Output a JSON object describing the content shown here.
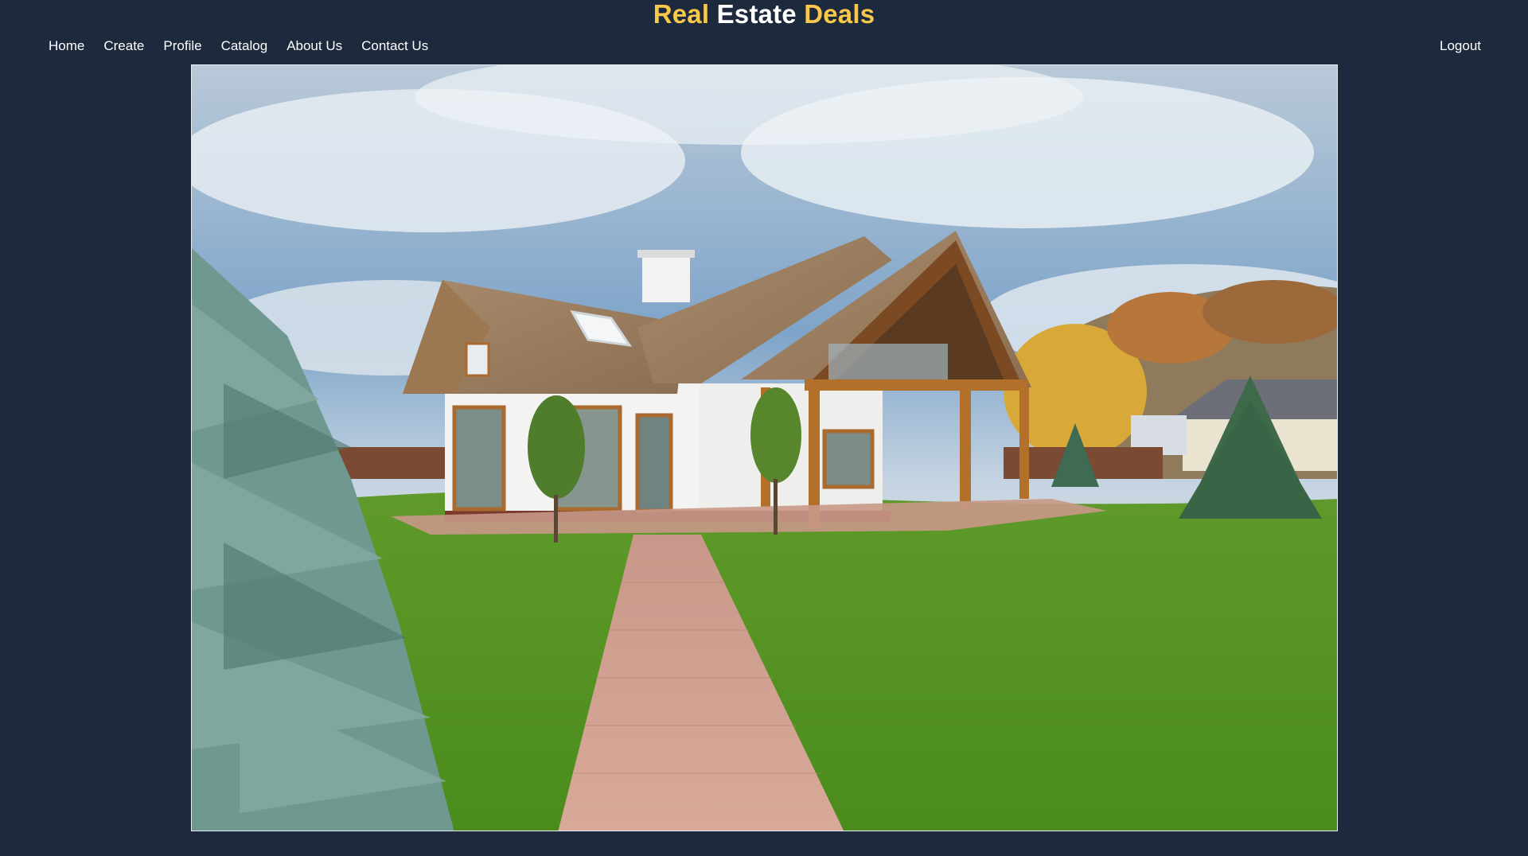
{
  "brand": {
    "word1": "Real",
    "word2": "Estate",
    "word3": "Deals"
  },
  "nav": {
    "items": [
      {
        "label": "Home"
      },
      {
        "label": "Create"
      },
      {
        "label": "Profile"
      },
      {
        "label": "Catalog"
      },
      {
        "label": "About Us"
      },
      {
        "label": "Contact Us"
      }
    ],
    "logout_label": "Logout"
  },
  "colors": {
    "background": "#1d293c",
    "brand_accent": "#f7c84a",
    "text": "#ffffff"
  },
  "hero": {
    "image_subject": "house-photo"
  }
}
